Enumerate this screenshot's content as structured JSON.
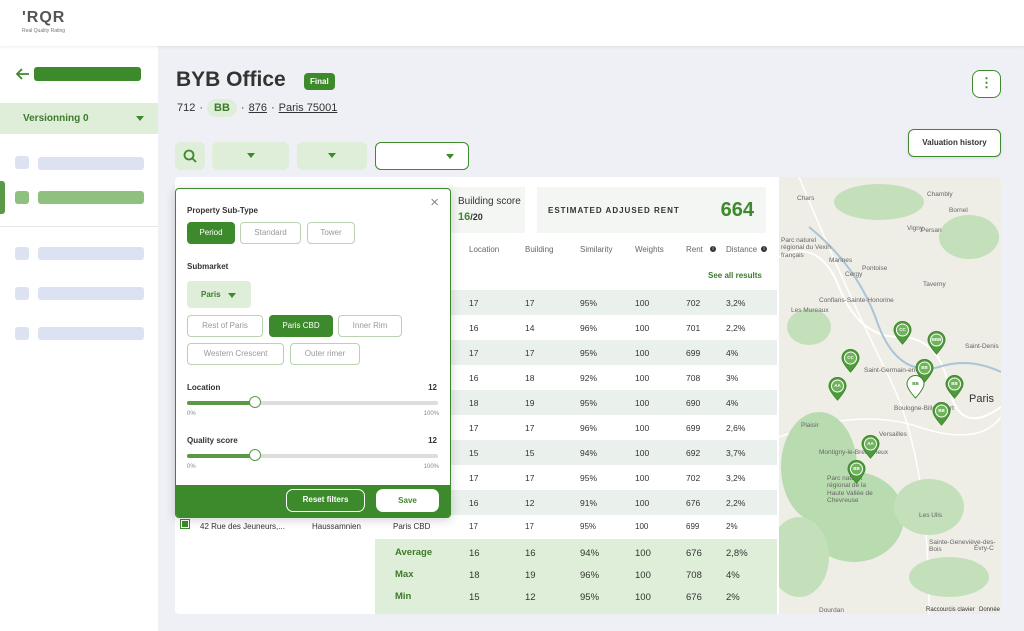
{
  "logo": {
    "mark": "'RQR",
    "tagline": "Real Quality Rating"
  },
  "sidebar": {
    "version_label": "Versionning 0"
  },
  "header": {
    "title": "BYB Office",
    "badge": "Final",
    "id": "712",
    "rating": "BB",
    "number": "876",
    "location": "Paris 75001",
    "more_symbol": "⋮",
    "valuation_history_label": "Valuation history"
  },
  "building_score": {
    "label": "Building score",
    "value": "16",
    "max": "/20"
  },
  "estimated_rent": {
    "label": "ESTIMATED ADJUSED RENT",
    "value": "664"
  },
  "table": {
    "columns": [
      "Location",
      "Building",
      "Similarity",
      "Weights",
      "Rent",
      "Distance"
    ],
    "see_all": "See all results",
    "rows": [
      [
        "17",
        "17",
        "95%",
        "100",
        "702",
        "3,2%"
      ],
      [
        "16",
        "14",
        "96%",
        "100",
        "701",
        "2,2%"
      ],
      [
        "17",
        "17",
        "95%",
        "100",
        "699",
        "4%"
      ],
      [
        "16",
        "18",
        "92%",
        "100",
        "708",
        "3%"
      ],
      [
        "18",
        "19",
        "95%",
        "100",
        "690",
        "4%"
      ],
      [
        "17",
        "17",
        "96%",
        "100",
        "699",
        "2,6%"
      ],
      [
        "15",
        "15",
        "94%",
        "100",
        "692",
        "3,7%"
      ],
      [
        "17",
        "17",
        "95%",
        "100",
        "702",
        "3,2%"
      ],
      [
        "16",
        "12",
        "91%",
        "100",
        "676",
        "2,2%"
      ]
    ],
    "last_row": {
      "address": "42 Rue des Jeuneurs,...",
      "style": "Haussamnien",
      "submarket": "Paris CBD",
      "values": [
        "17",
        "17",
        "95%",
        "100",
        "699",
        "2%"
      ]
    },
    "summary": [
      {
        "label": "Average",
        "values": [
          "16",
          "16",
          "94%",
          "100",
          "676",
          "2,8%"
        ]
      },
      {
        "label": "Max",
        "values": [
          "18",
          "19",
          "96%",
          "100",
          "708",
          "4%"
        ]
      },
      {
        "label": "Min",
        "values": [
          "15",
          "12",
          "95%",
          "100",
          "676",
          "2%"
        ]
      }
    ]
  },
  "map": {
    "labels": [
      "Chars",
      "Chambly",
      "Bornel",
      "Persan",
      "Marines",
      "Vigny",
      "Cergy",
      "Pontoise",
      "Taverny",
      "Conflans-Sainte-Honorine",
      "Les Mureaux",
      "Saint-Germain-en-Laye",
      "Boulogne-Billancourt",
      "Paris",
      "Versailles",
      "Saint-Denis",
      "Montigny-le-Bretonneux",
      "Plaisir",
      "Parc naturel régional de la Haute Vallée de Chevreuse",
      "Les Ulis",
      "Dourdan",
      "Sainte-Geneviève-des-Bois",
      "Évry-C",
      "Parc naturel régional du Vexin français"
    ],
    "pins": [
      "CC",
      "BBB",
      "CC",
      "BB",
      "BB",
      "AA",
      "BB",
      "BB",
      "AA",
      "BB"
    ],
    "footer": [
      "Raccourcis clavier",
      "Donnée"
    ]
  },
  "filter_panel": {
    "property_subtype_label": "Property Sub-Type",
    "subtypes": [
      "Period",
      "Standard",
      "Tower"
    ],
    "submarket_label": "Submarket",
    "submarket_selected": "Paris",
    "submarkets": [
      "Rest of Paris",
      "Paris CBD",
      "Inner Rim",
      "Western Crescent",
      "Outer rimer"
    ],
    "location_label": "Location",
    "location_value": "12",
    "location_fraction": 0.27,
    "quality_label": "Quality score",
    "quality_value": "12",
    "quality_fraction": 0.27,
    "min_label": "0%",
    "max_label": "100%",
    "reset_label": "Reset filters",
    "save_label": "Save",
    "close_symbol": "×"
  },
  "colors": {
    "accent": "#3d8a2c",
    "accent_light": "#dfeed8",
    "sidebar_placeholder": "#dde2f2"
  }
}
